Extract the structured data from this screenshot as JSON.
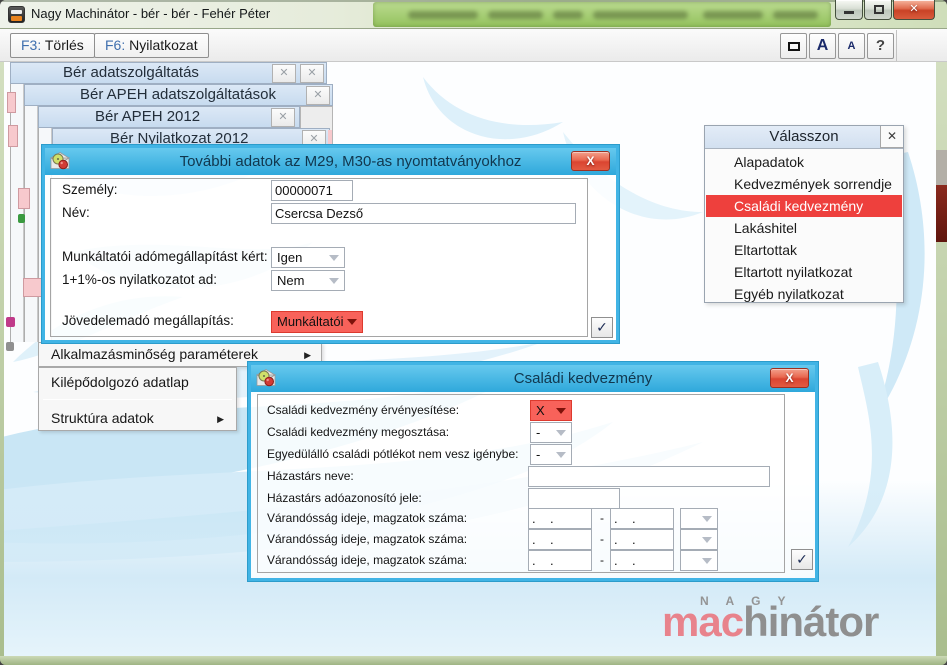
{
  "window": {
    "title": "Nagy Machinátor - bér - bér - Fehér Péter"
  },
  "toolbar": {
    "f3_key": "F3:",
    "f3_label": " Törlés",
    "f6_key": "F6:",
    "f6_label": " Nyilatkozat",
    "font_large_glyph": "A",
    "font_small_glyph": "A",
    "help_glyph": "?"
  },
  "stacked_windows": [
    {
      "title": "Bér adatszolgáltatás"
    },
    {
      "title": "Bér APEH adatszolgáltatások"
    },
    {
      "title": "Bér APEH 2012"
    },
    {
      "title": "Bér Nyilatkozat 2012"
    }
  ],
  "glyphs": {
    "titlebar_x": "✕",
    "mdi_x": "✕",
    "panel_x": "✕",
    "dialog_x": "X",
    "check": "✓",
    "submenu_arrow": "▶"
  },
  "dialog_m29": {
    "title": "További adatok az M29, M30-as nyomtatványokhoz",
    "szemely_label": "Személy:",
    "szemely_value": "00000071",
    "nev_label": "Név:",
    "nev_value": "Csercsa Dezső",
    "ado_label": "Munkáltatói adómegállapítást kért:",
    "ado_value": "Igen",
    "nyil_label": "1+1%-os nyilatkozatot ad:",
    "nyil_value": "Nem",
    "jov_label": "Jövedelemadó megállapítás:",
    "jov_value": "Munkáltatói"
  },
  "menu": {
    "item_alkalmazas": "Alkalmazásminőség paraméterek",
    "item_kilepo": "Kilépődolgozó adatlap",
    "item_struktura": "Struktúra adatok"
  },
  "valasszon": {
    "title": "Válasszon",
    "items": [
      {
        "label": "Alapadatok",
        "selected": false
      },
      {
        "label": "Kedvezmények sorrendje",
        "selected": false
      },
      {
        "label": "Családi kedvezmény",
        "selected": true
      },
      {
        "label": "Lakáshitel",
        "selected": false
      },
      {
        "label": "Eltartottak",
        "selected": false
      },
      {
        "label": "Eltartott nyilatkozat",
        "selected": false
      },
      {
        "label": "Egyéb nyilatkozat",
        "selected": false
      }
    ]
  },
  "dialog_csaladi": {
    "title": "Családi kedvezmény",
    "ervenyesites_label": "Családi kedvezmény érvényesítése:",
    "ervenyesites_value": "X",
    "megosztas_label": "Családi kedvezmény megosztása:",
    "megosztas_value": "-",
    "egyedulallo_label": "Egyedülálló családi pótlékot nem vesz igénybe:",
    "egyedulallo_value": "-",
    "hazastars_nev_label": "Házastárs neve:",
    "hazastars_nev_value": "",
    "hazastars_ado_label": "Házastárs adóazonosító jele:",
    "hazastars_ado_value": "",
    "varandossag_rows": [
      {
        "label": "Várandósság ideje, magzatok száma:",
        "from": ".    .",
        "dash": "-",
        "to": ".    ."
      },
      {
        "label": "Várandósság ideje, magzatok száma:",
        "from": ".    .",
        "dash": "-",
        "to": ".    ."
      },
      {
        "label": "Várandósság ideje, magzatok száma:",
        "from": ".    .",
        "dash": "-",
        "to": ".    ."
      }
    ]
  },
  "logo": {
    "top": "N A G Y",
    "accent": "mac",
    "rest": "hinátor"
  },
  "colors": {
    "dialog_accent": "#41b4e5",
    "selection_red": "#ee403d",
    "dropdown_red": "#f8625a",
    "mdi_titlebar_blue": "#cfe0f1",
    "frame_green": "#a9bd8d",
    "logo_pink": "#e8838c",
    "logo_gray": "#8f8f8f"
  }
}
